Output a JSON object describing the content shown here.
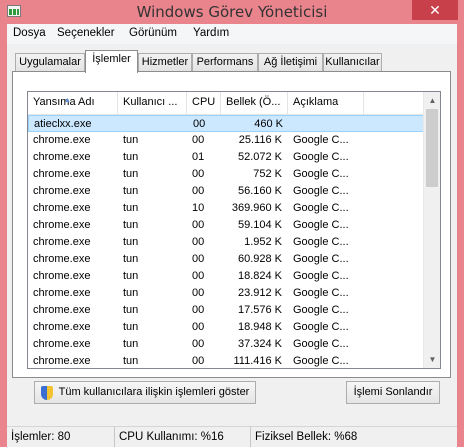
{
  "window": {
    "title": "Windows Görev Yöneticisi",
    "close_glyph": "✕"
  },
  "menu": [
    "Dosya",
    "Seçenekler",
    "Görünüm",
    "Yardım"
  ],
  "tabs": [
    "Uygulamalar",
    "İşlemler",
    "Hizmetler",
    "Performans",
    "Ağ İletişimi",
    "Kullanıcılar"
  ],
  "active_tab": "İşlemler",
  "columns": [
    "Yansıma Adı",
    "Kullanıcı ...",
    "CPU",
    "Bellek (Ö...",
    "Açıklama"
  ],
  "processes": [
    {
      "name": "atieclxx.exe",
      "user": "",
      "cpu": "00",
      "memory": "460 K",
      "desc": ""
    },
    {
      "name": "chrome.exe",
      "user": "tun",
      "cpu": "00",
      "memory": "25.116 K",
      "desc": "Google C..."
    },
    {
      "name": "chrome.exe",
      "user": "tun",
      "cpu": "01",
      "memory": "52.072 K",
      "desc": "Google C..."
    },
    {
      "name": "chrome.exe",
      "user": "tun",
      "cpu": "00",
      "memory": "752 K",
      "desc": "Google C..."
    },
    {
      "name": "chrome.exe",
      "user": "tun",
      "cpu": "00",
      "memory": "56.160 K",
      "desc": "Google C..."
    },
    {
      "name": "chrome.exe",
      "user": "tun",
      "cpu": "10",
      "memory": "369.960 K",
      "desc": "Google C..."
    },
    {
      "name": "chrome.exe",
      "user": "tun",
      "cpu": "00",
      "memory": "59.104 K",
      "desc": "Google C..."
    },
    {
      "name": "chrome.exe",
      "user": "tun",
      "cpu": "00",
      "memory": "1.952 K",
      "desc": "Google C..."
    },
    {
      "name": "chrome.exe",
      "user": "tun",
      "cpu": "00",
      "memory": "60.928 K",
      "desc": "Google C..."
    },
    {
      "name": "chrome.exe",
      "user": "tun",
      "cpu": "00",
      "memory": "18.824 K",
      "desc": "Google C..."
    },
    {
      "name": "chrome.exe",
      "user": "tun",
      "cpu": "00",
      "memory": "23.912 K",
      "desc": "Google C..."
    },
    {
      "name": "chrome.exe",
      "user": "tun",
      "cpu": "00",
      "memory": "17.576 K",
      "desc": "Google C..."
    },
    {
      "name": "chrome.exe",
      "user": "tun",
      "cpu": "00",
      "memory": "18.948 K",
      "desc": "Google C..."
    },
    {
      "name": "chrome.exe",
      "user": "tun",
      "cpu": "00",
      "memory": "37.324 K",
      "desc": "Google C..."
    },
    {
      "name": "chrome.exe",
      "user": "tun",
      "cpu": "00",
      "memory": "111.416 K",
      "desc": "Google C..."
    }
  ],
  "selected_row": 0,
  "buttons": {
    "show_all": "Tüm kullanıcılara ilişkin işlemleri göster",
    "end_process": "İşlemi Sonlandır"
  },
  "status": {
    "processes": "İşlemler: 80",
    "cpu": "CPU Kullanımı: %16",
    "memory": "Fiziksel Bellek: %68"
  },
  "colors": {
    "titlebar": "#e9848d",
    "close_button": "#c7404a",
    "selection": "#cce8ff"
  },
  "icons": [
    "task-manager-icon",
    "close-icon",
    "sort-asc-icon",
    "scroll-up-icon",
    "scroll-down-icon",
    "uac-shield-icon"
  ]
}
